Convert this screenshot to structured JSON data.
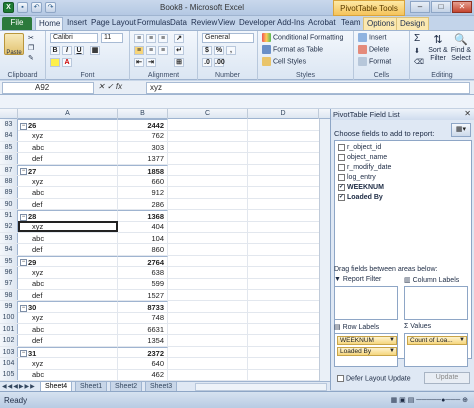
{
  "app": {
    "title": "Book8 - Microsoft Excel",
    "pivot_tools": "PivotTable Tools"
  },
  "tabs": [
    {
      "label": "File"
    },
    {
      "label": "Home"
    },
    {
      "label": "Insert"
    },
    {
      "label": "Page Layout"
    },
    {
      "label": "Formulas"
    },
    {
      "label": "Data"
    },
    {
      "label": "Review"
    },
    {
      "label": "View"
    },
    {
      "label": "Developer"
    },
    {
      "label": "Add-Ins"
    },
    {
      "label": "Acrobat"
    },
    {
      "label": "Team"
    },
    {
      "label": "Options"
    },
    {
      "label": "Design"
    }
  ],
  "ribbon": {
    "clipboard": {
      "label": "Clipboard",
      "paste": "Paste"
    },
    "font": {
      "label": "Font",
      "name": "Calibri",
      "size": "11",
      "bold": "B",
      "italic": "I",
      "underline": "U"
    },
    "alignment": {
      "label": "Alignment"
    },
    "number": {
      "label": "Number",
      "format": "General",
      "currency": "$",
      "percent": "%",
      "comma": ","
    },
    "styles": {
      "label": "Styles",
      "conditional": "Conditional Formatting",
      "format_table": "Format as Table",
      "cell_styles": "Cell Styles"
    },
    "cells": {
      "label": "Cells",
      "insert": "Insert",
      "delete": "Delete",
      "format": "Format"
    },
    "editing": {
      "label": "Editing",
      "sum": "Σ",
      "sort": "Sort & Filter",
      "find": "Find & Select"
    }
  },
  "formula_bar": {
    "name_box": "A92",
    "fx": "fx",
    "value": "xyz"
  },
  "columns": [
    "A",
    "B",
    "C",
    "D"
  ],
  "rows": [
    {
      "n": "83",
      "type": "group",
      "a": "26",
      "b": "2442"
    },
    {
      "n": "84",
      "type": "item",
      "a": "xyz",
      "b": "762"
    },
    {
      "n": "85",
      "type": "item",
      "a": "abc",
      "b": "303"
    },
    {
      "n": "86",
      "type": "item",
      "a": "def",
      "b": "1377"
    },
    {
      "n": "87",
      "type": "group",
      "a": "27",
      "b": "1858"
    },
    {
      "n": "88",
      "type": "item",
      "a": "xyz",
      "b": "660"
    },
    {
      "n": "89",
      "type": "item",
      "a": "abc",
      "b": "912"
    },
    {
      "n": "90",
      "type": "item",
      "a": "def",
      "b": "286"
    },
    {
      "n": "91",
      "type": "group",
      "a": "28",
      "b": "1368"
    },
    {
      "n": "92",
      "type": "item",
      "a": "xyz",
      "b": "404"
    },
    {
      "n": "93",
      "type": "item",
      "a": "abc",
      "b": "104"
    },
    {
      "n": "94",
      "type": "item",
      "a": "def",
      "b": "860"
    },
    {
      "n": "95",
      "type": "group",
      "a": "29",
      "b": "2764"
    },
    {
      "n": "96",
      "type": "item",
      "a": "xyz",
      "b": "638"
    },
    {
      "n": "97",
      "type": "item",
      "a": "abc",
      "b": "599"
    },
    {
      "n": "98",
      "type": "item",
      "a": "def",
      "b": "1527"
    },
    {
      "n": "99",
      "type": "group",
      "a": "30",
      "b": "8733"
    },
    {
      "n": "100",
      "type": "item",
      "a": "xyz",
      "b": "748"
    },
    {
      "n": "101",
      "type": "item",
      "a": "abc",
      "b": "6631"
    },
    {
      "n": "102",
      "type": "item",
      "a": "def",
      "b": "1354"
    },
    {
      "n": "103",
      "type": "group",
      "a": "31",
      "b": "2372"
    },
    {
      "n": "104",
      "type": "item",
      "a": "xyz",
      "b": "640"
    },
    {
      "n": "105",
      "type": "item",
      "a": "abc",
      "b": "462"
    }
  ],
  "sheet_tabs": [
    {
      "label": "Sheet4",
      "active": true
    },
    {
      "label": "Sheet1"
    },
    {
      "label": "Sheet2"
    },
    {
      "label": "Sheet3"
    }
  ],
  "status": {
    "text": "Ready"
  },
  "pivot_panel": {
    "title": "PivotTable Field List",
    "choose": "Choose fields to add to report:",
    "fields": [
      {
        "label": "r_object_id",
        "checked": false
      },
      {
        "label": "object_name",
        "checked": false
      },
      {
        "label": "r_modify_date",
        "checked": false
      },
      {
        "label": "log_entry",
        "checked": false
      },
      {
        "label": "WEEKNUM",
        "checked": true
      },
      {
        "label": "Loaded By",
        "checked": true
      }
    ],
    "drag_title": "Drag fields between areas below:",
    "report_filter": "Report Filter",
    "column_labels": "Column Labels",
    "row_labels": "Row Labels",
    "values": "Values",
    "row_fields": [
      "WEEKNUM",
      "Loaded By"
    ],
    "value_fields": [
      "Count of Loa..."
    ],
    "defer": "Defer Layout Update",
    "update": "Update"
  },
  "colors": {
    "file_tab": "#2c7a3c",
    "pivot_tools": "#f5c35b",
    "selection": "#cfe0f5"
  }
}
